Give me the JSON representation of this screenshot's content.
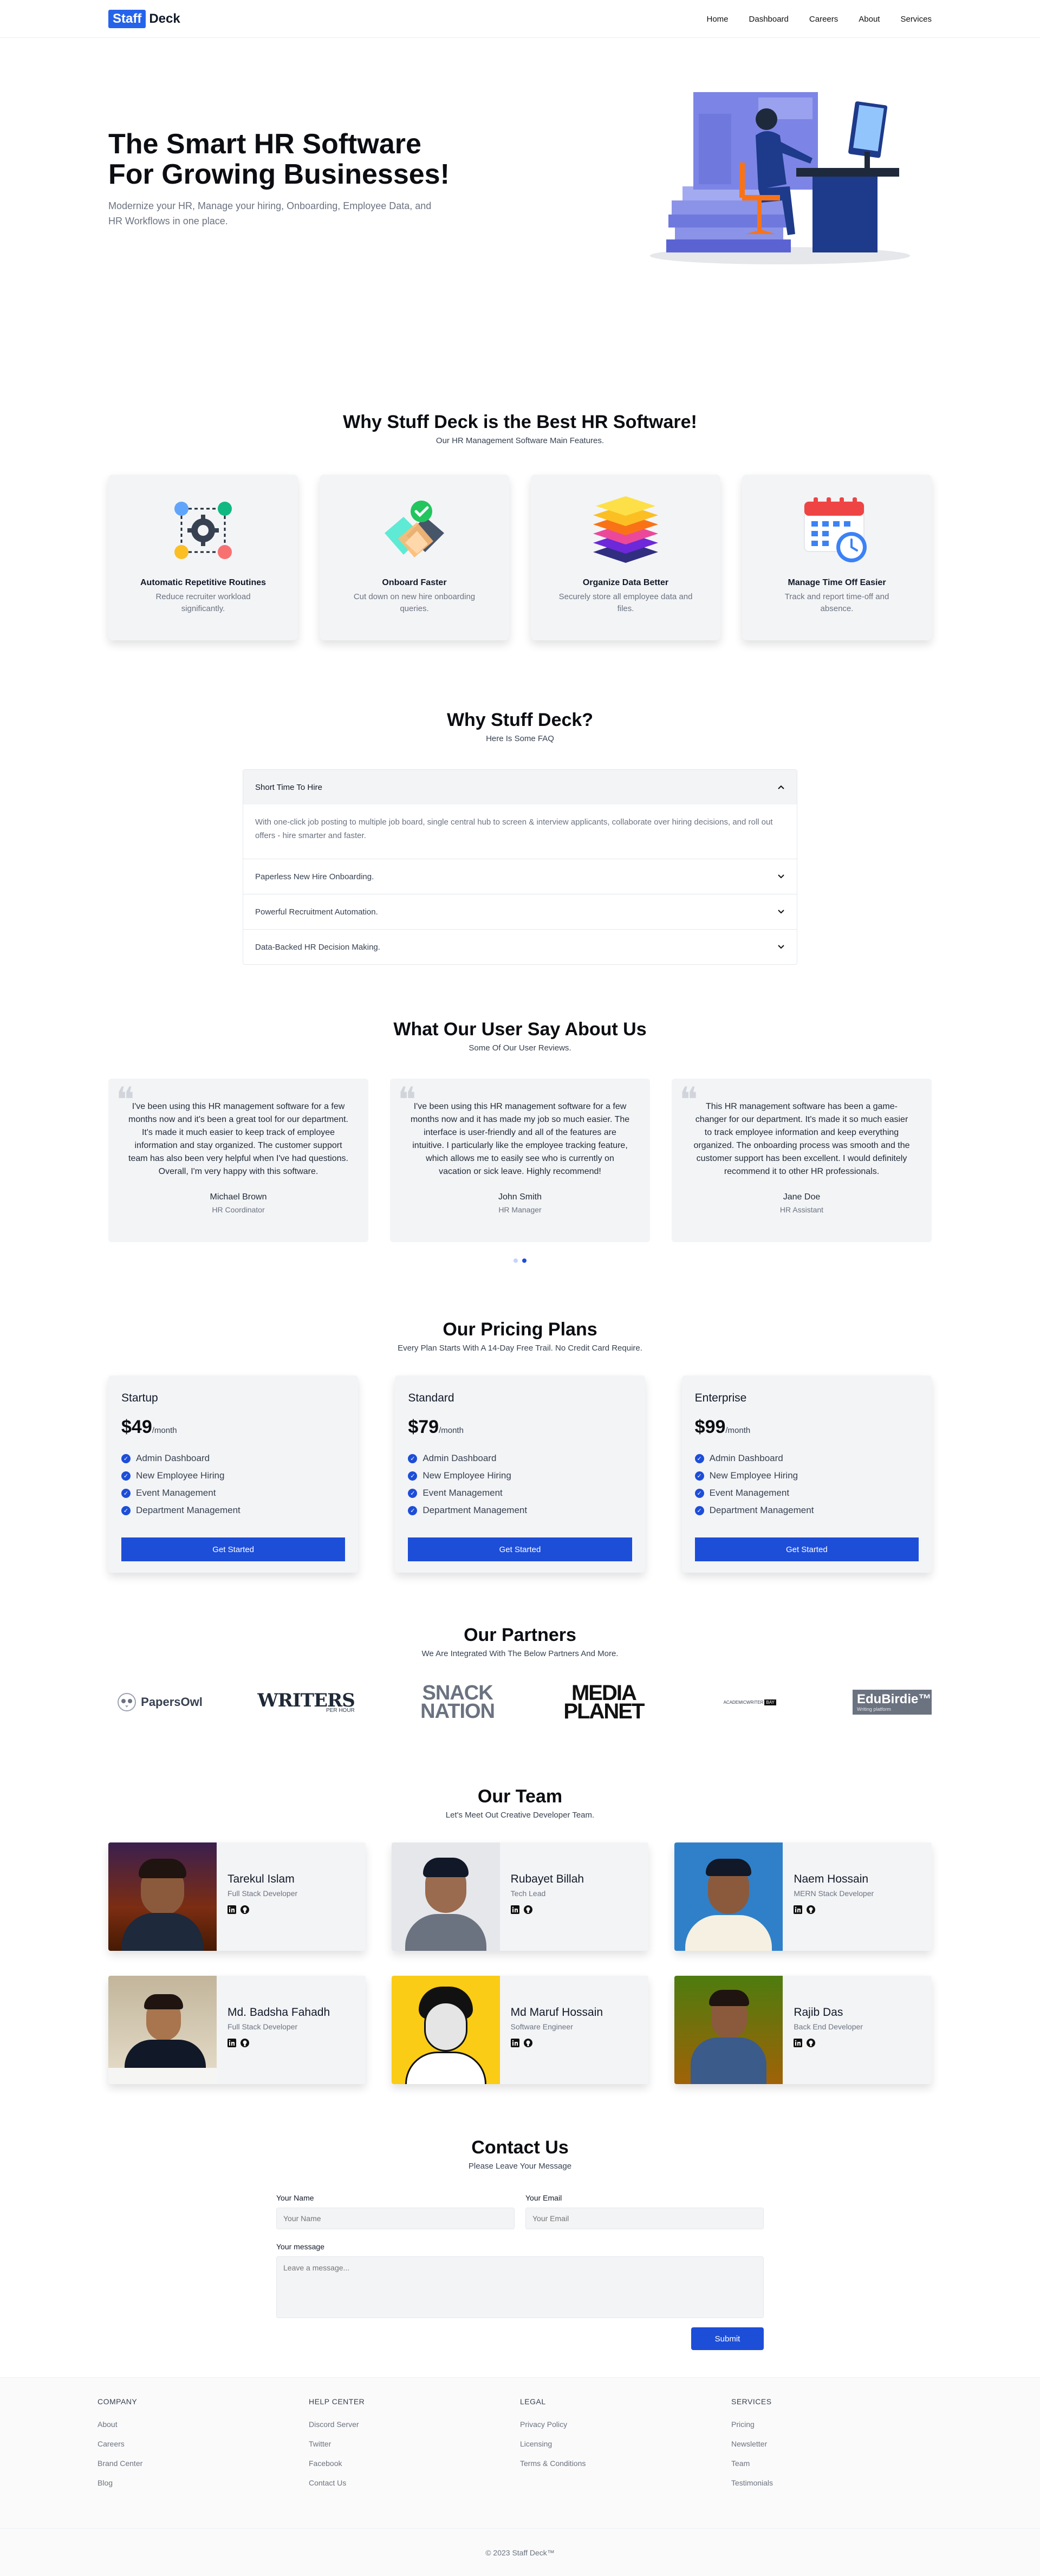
{
  "nav": {
    "logo_badge": "Staff",
    "logo_text": "Deck",
    "links": [
      "Home",
      "Dashboard",
      "Careers",
      "About",
      "Services"
    ]
  },
  "hero": {
    "title_line1": "The Smart HR Software",
    "title_line2": "For Growing Businesses!",
    "subtitle": "Modernize your HR, Manage your hiring, Onboarding, Employee Data, and HR Workflows in one place."
  },
  "features": {
    "title": "Why Stuff Deck is the Best HR Software!",
    "subtitle": "Our HR Management Software Main Features.",
    "items": [
      {
        "title": "Automatic Repetitive Routines",
        "desc": "Reduce recruiter workload significantly.",
        "icon": "workflow-icon"
      },
      {
        "title": "Onboard Faster",
        "desc": "Cut down on new hire onboarding queries.",
        "icon": "handshake-check-icon"
      },
      {
        "title": "Organize Data Better",
        "desc": "Securely store all employee data and files.",
        "icon": "layers-icon"
      },
      {
        "title": "Manage Time Off Easier",
        "desc": "Track and report time-off and absence.",
        "icon": "calendar-clock-icon"
      }
    ]
  },
  "faq": {
    "title": "Why Stuff Deck?",
    "subtitle": "Here Is Some FAQ",
    "items": [
      {
        "q": "Short Time To Hire",
        "a": "With one-click job posting to multiple job board, single central hub to screen & interview applicants, collaborate over hiring decisions, and roll out offers - hire smarter and faster."
      },
      {
        "q": "Paperless New Hire Onboarding."
      },
      {
        "q": "Powerful Recruitment Automation."
      },
      {
        "q": "Data-Backed HR Decision Making."
      }
    ]
  },
  "testimonials": {
    "title": "What Our User Say About Us",
    "subtitle": "Some Of Our User Reviews.",
    "items": [
      {
        "text": "I've been using this HR management software for a few months now and it's been a great tool for our department. It's made it much easier to keep track of employee information and stay organized. The customer support team has also been very helpful when I've had questions. Overall, I'm very happy with this software.",
        "name": "Michael Brown",
        "role": "HR Coordinator"
      },
      {
        "text": "I've been using this HR management software for a few months now and it has made my job so much easier. The interface is user-friendly and all of the features are intuitive. I particularly like the employee tracking feature, which allows me to easily see who is currently on vacation or sick leave. Highly recommend!",
        "name": "John Smith",
        "role": "HR Manager"
      },
      {
        "text": "This HR management software has been a game-changer for our department. It's made it so much easier to track employee information and keep everything organized. The onboarding process was smooth and the customer support has been excellent. I would definitely recommend it to other HR professionals.",
        "name": "Jane Doe",
        "role": "HR Assistant"
      }
    ]
  },
  "pricing": {
    "title": "Our Pricing Plans",
    "subtitle": "Every Plan Starts With A 14-Day Free Trail. No Credit Card Require.",
    "features": [
      "Admin Dashboard",
      "New Employee Hiring",
      "Event Management",
      "Department Management"
    ],
    "button": "Get Started",
    "per": "/month",
    "plans": [
      {
        "name": "Startup",
        "price": "$49"
      },
      {
        "name": "Standard",
        "price": "$79"
      },
      {
        "name": "Enterprise",
        "price": "$99"
      }
    ]
  },
  "partners": {
    "title": "Our Partners",
    "subtitle": "We Are Integrated With The Below Partners And More.",
    "items": [
      {
        "name": "PapersOwl"
      },
      {
        "name": "WRITERS",
        "tag": "PER HOUR"
      },
      {
        "name": "SNACK",
        "line2": "NATION"
      },
      {
        "name": "MEDIA",
        "line2": "PLANET"
      },
      {
        "name": "ACADEMICWRITER",
        "tag": "BAY"
      },
      {
        "name": "EduBirdie™",
        "tag": "Writing platform"
      }
    ]
  },
  "team": {
    "title": "Our Team",
    "subtitle": "Let's Meet Out Creative Developer Team.",
    "members": [
      {
        "name": "Tarekul Islam",
        "role": "Full Stack Developer"
      },
      {
        "name": "Rubayet Billah",
        "role": "Tech Lead"
      },
      {
        "name": "Naem Hossain",
        "role": "MERN Stack Developer"
      },
      {
        "name": "Md. Badsha Fahadh",
        "role": "Full Stack Developer"
      },
      {
        "name": "Md Maruf Hossain",
        "role": "Software Engineer"
      },
      {
        "name": "Rajib Das",
        "role": "Back End Developer"
      }
    ]
  },
  "contact": {
    "title": "Contact Us",
    "subtitle": "Please Leave Your Message",
    "name_label": "Your Name",
    "name_placeholder": "Your Name",
    "email_label": "Your Email",
    "email_placeholder": "Your Email",
    "message_label": "Your message",
    "message_placeholder": "Leave a message...",
    "submit": "Submit"
  },
  "footer": {
    "columns": [
      {
        "title": "COMPANY",
        "links": [
          "About",
          "Careers",
          "Brand Center",
          "Blog"
        ]
      },
      {
        "title": "HELP CENTER",
        "links": [
          "Discord Server",
          "Twitter",
          "Facebook",
          "Contact Us"
        ]
      },
      {
        "title": "LEGAL",
        "links": [
          "Privacy Policy",
          "Licensing",
          "Terms & Conditions"
        ]
      },
      {
        "title": "SERVICES",
        "links": [
          "Pricing",
          "Newsletter",
          "Team",
          "Testimonials"
        ]
      }
    ],
    "copyright": "© 2023 Staff Deck™"
  },
  "colors": {
    "primary": "#1d4ed8",
    "logo_blue": "#2563eb",
    "card_bg": "#f3f4f6"
  }
}
